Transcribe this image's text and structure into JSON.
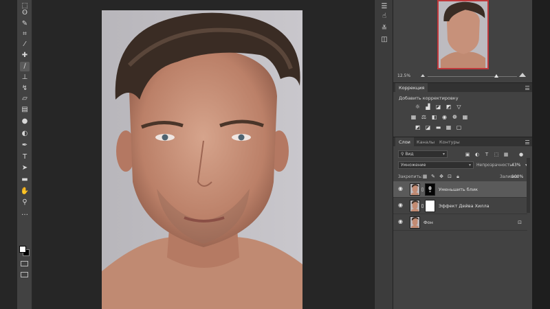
{
  "toolbar": {
    "tools": [
      {
        "name": "marquee-tool-icon",
        "glyph": "⬚"
      },
      {
        "name": "lasso-tool-icon",
        "glyph": "ʘ"
      },
      {
        "name": "quick-select-icon",
        "glyph": "✎"
      },
      {
        "name": "crop-tool-icon",
        "glyph": "⌗"
      },
      {
        "name": "eyedropper-icon",
        "glyph": "⁄"
      },
      {
        "name": "spot-heal-icon",
        "glyph": "✚"
      },
      {
        "name": "brush-tool-icon",
        "glyph": "∕"
      },
      {
        "name": "clone-stamp-icon",
        "glyph": "⊥"
      },
      {
        "name": "history-brush-icon",
        "glyph": "↯"
      },
      {
        "name": "eraser-icon",
        "glyph": "▱"
      },
      {
        "name": "gradient-icon",
        "glyph": "▤"
      },
      {
        "name": "blur-tool-icon",
        "glyph": "●"
      },
      {
        "name": "dodge-tool-icon",
        "glyph": "◐"
      },
      {
        "name": "pen-tool-icon",
        "glyph": "✒"
      },
      {
        "name": "type-tool-icon",
        "glyph": "T"
      },
      {
        "name": "path-select-icon",
        "glyph": "➤"
      },
      {
        "name": "shape-tool-icon",
        "glyph": "▬"
      },
      {
        "name": "hand-tool-icon",
        "glyph": "✋"
      },
      {
        "name": "zoom-tool-icon",
        "glyph": "⚲"
      },
      {
        "name": "more-tools-icon",
        "glyph": "…"
      }
    ]
  },
  "strip_icons": [
    {
      "name": "properties-icon",
      "glyph": "☰"
    },
    {
      "name": "hand-pointer-icon",
      "glyph": "☝"
    },
    {
      "name": "adjustments-sliders-icon",
      "glyph": "≚"
    },
    {
      "name": "libraries-icon",
      "glyph": "◫"
    }
  ],
  "navigator": {
    "zoom": "12.5%"
  },
  "adjustments": {
    "tab": "Коррекция",
    "subtitle": "Добавить корректировку",
    "icons_row1": [
      "☼",
      "▟",
      "◪",
      "◩",
      "▽"
    ],
    "icons_row2": [
      "▦",
      "⚖",
      "◧",
      "◉",
      "❁",
      "▦"
    ],
    "icons_row3": [
      "◩",
      "◪",
      "▬",
      "▦",
      "▢"
    ]
  },
  "layers_panel": {
    "tabs": [
      "Слои",
      "Каналы",
      "Контуры"
    ],
    "filter_label": "Вид",
    "blend_mode": "Умножение",
    "opacity_label": "Непрозрачность:",
    "opacity_value": "43%",
    "lock_label": "Закрепить:",
    "fill_label": "Заливка:",
    "fill_value": "100%",
    "layers": [
      {
        "name": "Уменьшить блик",
        "selected": true
      },
      {
        "name": "Эффект Дейва Хилла",
        "selected": false
      },
      {
        "name": "Фон",
        "selected": false,
        "locked": true
      }
    ]
  },
  "colors": {
    "background": "#262626",
    "panel": "#424242",
    "selected_layer": "#5a5a5a",
    "nav_border": "#c0393c"
  }
}
